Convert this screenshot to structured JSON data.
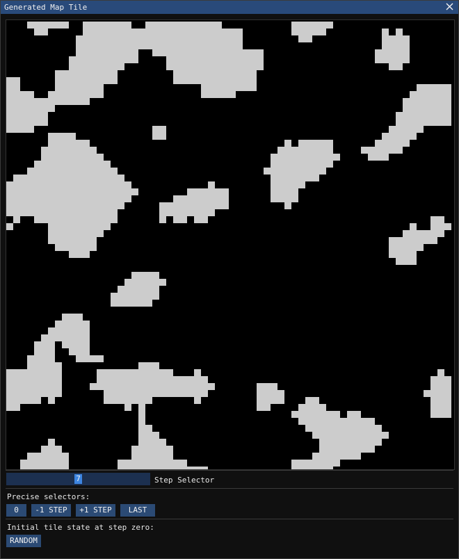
{
  "window": {
    "title": "Generated Map Tile",
    "close_icon": "close-icon"
  },
  "map": {
    "description_colors": {
      "land": "#cccccc",
      "water": "#000000"
    }
  },
  "step_selector": {
    "value": "7",
    "label": "Step Selector",
    "fraction": 0.5
  },
  "precise_selectors": {
    "label": "Precise selectors:",
    "buttons": [
      "0",
      "-1 STEP",
      "+1 STEP",
      "LAST"
    ]
  },
  "initial_state": {
    "label": "Initial tile state at step zero:",
    "button": "RANDOM"
  },
  "colors": {
    "title_bar": "#294a7a",
    "button": "#2b4a74",
    "slider_track": "#1c3050",
    "slider_grab": "#3d85e0"
  }
}
